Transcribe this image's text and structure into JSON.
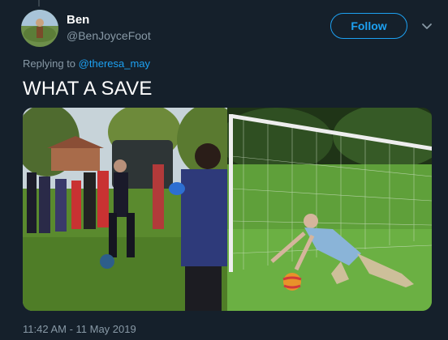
{
  "tweet": {
    "author_name": "Ben",
    "author_handle": "@BenJoyceFoot",
    "follow_label": "Follow",
    "reply_prefix": "Replying to",
    "reply_mention": "@theresa_may",
    "text": "WHAT A SAVE",
    "timestamp": "11:42 AM - 11 May 2019"
  },
  "icons": {
    "more": "chevron-down-icon"
  },
  "colors": {
    "background": "#15202b",
    "accent": "#1da1f2",
    "secondary_text": "#8899a6",
    "primary_text": "#ffffff"
  }
}
